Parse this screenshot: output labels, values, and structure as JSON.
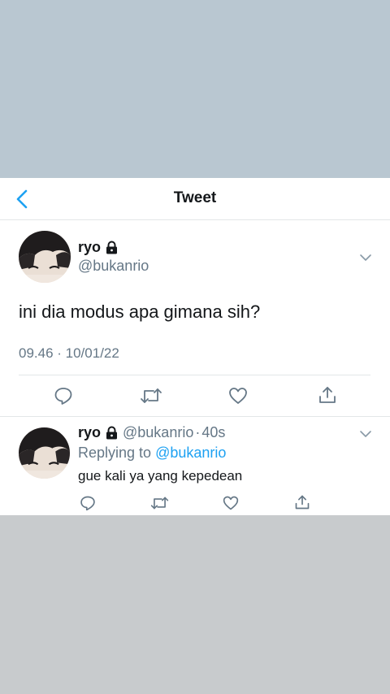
{
  "header": {
    "title": "Tweet",
    "back_icon": "chevron-left-icon"
  },
  "tweet": {
    "name": "ryo",
    "handle": "@bukanrio",
    "text": "ini dia modus apa gimana sih?",
    "timestamp": "09.46 · 10/01/22",
    "actions": [
      "reply-icon",
      "retweet-icon",
      "like-icon",
      "share-icon"
    ]
  },
  "reply": {
    "name": "ryo",
    "handle": "@bukanrio",
    "separator": "·",
    "time": "40s",
    "replying_prefix": "Replying to",
    "replying_to": "@bukanrio",
    "text": "gue kali ya yang kepedean",
    "actions": [
      "reply-icon",
      "retweet-icon",
      "like-icon",
      "share-icon"
    ]
  },
  "colors": {
    "accent": "#1da1f2",
    "text": "#14171a",
    "secondary_text": "#657786",
    "background_top": "#b9c7d1",
    "background_bottom": "#c8cbcd"
  }
}
